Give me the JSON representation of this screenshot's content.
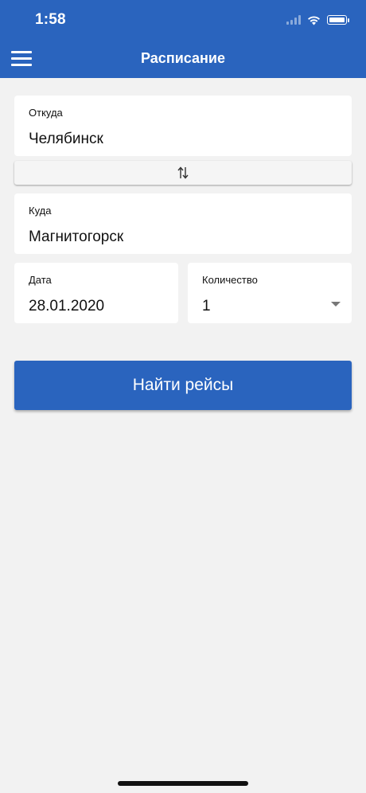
{
  "status_bar": {
    "time": "1:58"
  },
  "header": {
    "title": "Расписание",
    "menu_icon": "hamburger-menu-icon"
  },
  "form": {
    "from": {
      "label": "Откуда",
      "value": "Челябинск"
    },
    "swap": {
      "icon": "swap-arrows-icon"
    },
    "to": {
      "label": "Куда",
      "value": "Магнитогорск"
    },
    "date": {
      "label": "Дата",
      "value": "28.01.2020"
    },
    "count": {
      "label": "Количество",
      "value": "1"
    }
  },
  "search_button": {
    "label": "Найти рейсы"
  },
  "colors": {
    "primary": "#2a64be",
    "background": "#f2f2f2",
    "card": "#ffffff"
  }
}
